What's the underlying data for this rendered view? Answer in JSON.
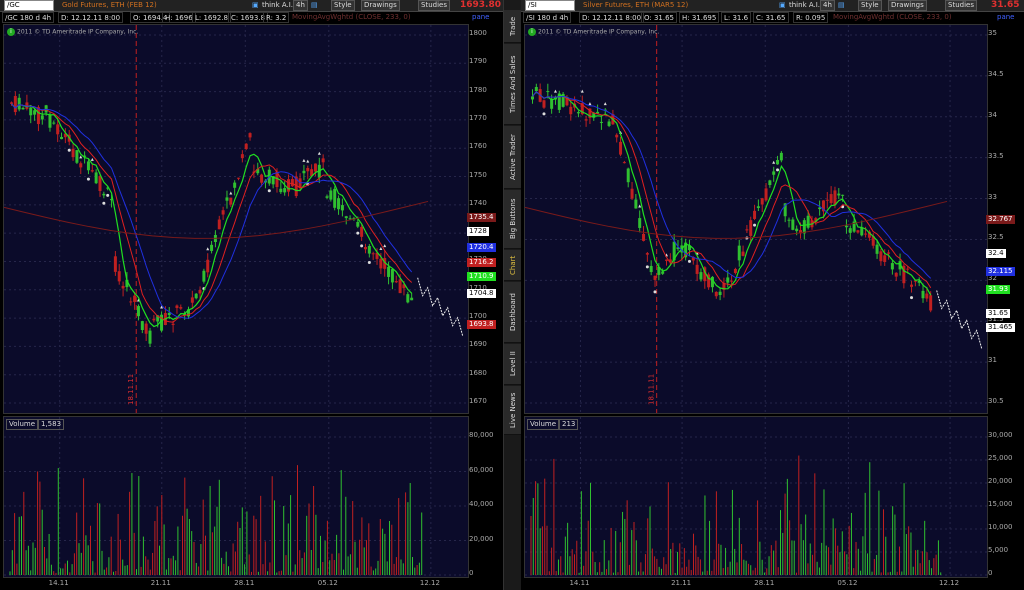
{
  "colors": {
    "bg": "#0b0b2a",
    "up": "#30c030",
    "down": "#c02020",
    "green_ma": "#20e020",
    "red_ma": "#e02020",
    "blue_ma": "#2030e0",
    "long_ma": "#7a1a1a",
    "price_accent": "#e03030"
  },
  "side_tabs": [
    "Trade",
    "Times And Sales",
    "Active Trader",
    "Big Buttons",
    "Chart",
    "Dashboard",
    "Level II",
    "Live News"
  ],
  "active_tab": "Chart",
  "copyright": "2011 © TD Ameritrade IP Company, Inc.",
  "toolbar": {
    "think_ai": "think A.I.",
    "timeframe": "4h",
    "style": "Style",
    "drawings": "Drawings",
    "studies": "Studies"
  },
  "gold": {
    "symbol": "/GC",
    "name": "Gold Futures, ETH (FEB 12)",
    "last": "1693.80",
    "info": {
      "interval": "/GC 180 d 4h",
      "d": "D: 12.12.11 8:00",
      "o": "O: 1694.4",
      "h": "H: 1696",
      "l": "L: 1692.8",
      "c": "C: 1693.8",
      "r": "R: 3.2",
      "study": "MovingAvgWghtd (CLOSE, 233, 0)",
      "pane": "pane"
    },
    "date_marker": "18.11.11",
    "price_ticks": [
      "1800",
      "1790",
      "1780",
      "1770",
      "1760",
      "1750",
      "1740",
      "1730",
      "1720",
      "1710",
      "1700",
      "1690",
      "1680",
      "1670"
    ],
    "price_tags": [
      {
        "label": "1735.4",
        "color": "#7a1a1a"
      },
      {
        "label": "1728",
        "color": "#ffffff"
      },
      {
        "label": "1720.4",
        "color": "#2030e0"
      },
      {
        "label": "1716.2",
        "color": "#c02020"
      },
      {
        "label": "1710.9",
        "color": "#20e020"
      },
      {
        "label": "1704.8",
        "color": "#ffffff"
      },
      {
        "label": "1693.8",
        "color": "#c02020"
      }
    ],
    "volume_label": "Volume",
    "volume_value": "1,583",
    "volume_ticks": [
      "80,000",
      "60,000",
      "40,000",
      "20,000",
      "0"
    ],
    "date_ticks": [
      "14.11",
      "21.11",
      "28.11",
      "05.12",
      "12.12"
    ]
  },
  "silver": {
    "symbol": "/SI",
    "name": "Silver Futures, ETH (MAR5 12)",
    "last": "31.65",
    "info": {
      "interval": "/SI 180 d 4h",
      "d": "D: 12.12.11 8:00",
      "o": "O: 31.65",
      "h": "H: 31.695",
      "l": "L: 31.6",
      "c": "C: 31.65",
      "r": "R: 0.095",
      "study": "MovingAvgWghtd (CLOSE, 233, 0)",
      "pane": "pane"
    },
    "date_marker": "18.11.11",
    "price_ticks": [
      "35",
      "34.5",
      "34",
      "33.5",
      "33",
      "32.5",
      "32",
      "31.5",
      "31",
      "30.5"
    ],
    "price_tags": [
      {
        "label": "32.767",
        "color": "#7a1a1a"
      },
      {
        "label": "32.4",
        "color": "#ffffff"
      },
      {
        "label": "32.115",
        "color": "#2030e0"
      },
      {
        "label": "31.93",
        "color": "#20e020"
      },
      {
        "label": "31.65",
        "color": "#ffffff"
      },
      {
        "label": "31.465",
        "color": "#ffffff"
      }
    ],
    "volume_label": "Volume",
    "volume_value": "213",
    "volume_ticks": [
      "30,000",
      "25,000",
      "20,000",
      "15,000",
      "10,000",
      "5,000",
      "0"
    ],
    "date_ticks": [
      "14.11",
      "21.11",
      "28.11",
      "05.12",
      "12.12"
    ]
  }
}
